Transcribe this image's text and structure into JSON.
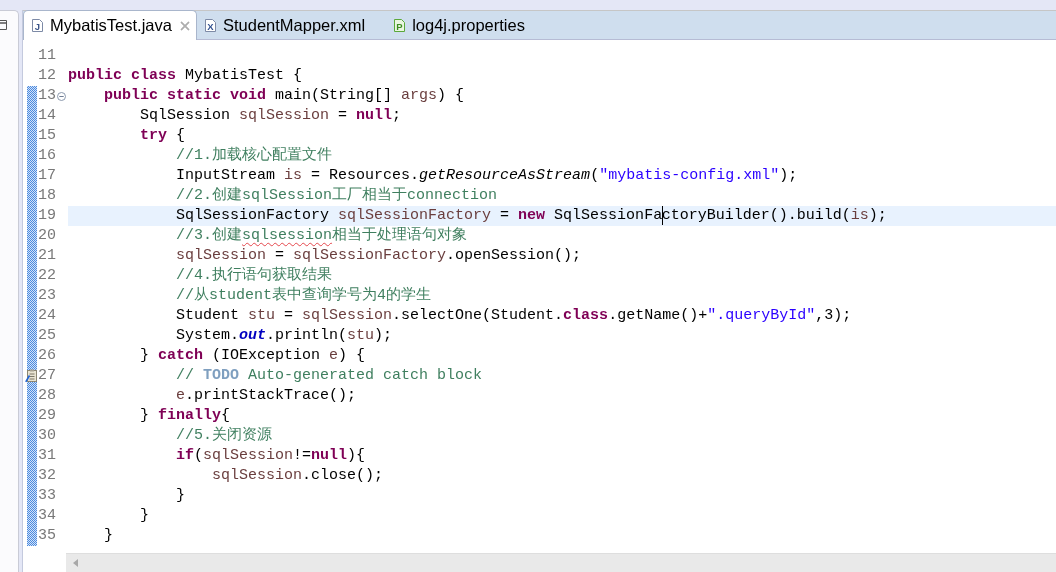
{
  "tabs": [
    {
      "label": "MybatisTest.java",
      "kind": "java",
      "icon_letter": "J",
      "selected": true
    },
    {
      "label": "StudentMapper.xml",
      "kind": "xml",
      "icon_letter": "X",
      "selected": false
    },
    {
      "label": "log4j.properties",
      "kind": "properties",
      "icon_letter": "P",
      "selected": false
    }
  ],
  "editor": {
    "lines": [
      {
        "number": "11",
        "changed": false,
        "current": false,
        "task_marker": false
      },
      {
        "number": "12",
        "changed": false,
        "current": false,
        "task_marker": false,
        "tokens": [
          {
            "text": "public class",
            "kind": "keyword"
          },
          {
            "text": " MybatisTest {",
            "kind": "plain"
          }
        ]
      },
      {
        "number": "13",
        "changed": true,
        "current": false,
        "task_marker": false,
        "fold": {
          "expanded": true
        },
        "tokens": [
          {
            "text": "    public static void",
            "kind": "keyword"
          },
          {
            "text": " main(String[] ",
            "kind": "plain"
          },
          {
            "text": "args",
            "kind": "local"
          },
          {
            "text": ") {",
            "kind": "plain"
          }
        ]
      },
      {
        "number": "14",
        "changed": true,
        "current": false,
        "task_marker": false,
        "tokens": [
          {
            "text": "        SqlSession ",
            "kind": "plain"
          },
          {
            "text": "sqlSession",
            "kind": "local"
          },
          {
            "text": " = ",
            "kind": "plain"
          },
          {
            "text": "null",
            "kind": "keyword"
          },
          {
            "text": ";",
            "kind": "plain"
          }
        ]
      },
      {
        "number": "15",
        "changed": true,
        "current": false,
        "task_marker": false,
        "tokens": [
          {
            "text": "        try",
            "kind": "keyword"
          },
          {
            "text": " {",
            "kind": "plain"
          }
        ]
      },
      {
        "number": "16",
        "changed": true,
        "current": false,
        "task_marker": false,
        "tokens": [
          {
            "text": "            //1.加载核心配置文件",
            "kind": "comment"
          }
        ]
      },
      {
        "number": "17",
        "changed": true,
        "current": false,
        "task_marker": false,
        "tokens": [
          {
            "text": "            InputStream ",
            "kind": "plain"
          },
          {
            "text": "is",
            "kind": "local"
          },
          {
            "text": " = Resources.",
            "kind": "plain"
          },
          {
            "text": "getResourceAsStream",
            "kind": "static_method"
          },
          {
            "text": "(",
            "kind": "plain"
          },
          {
            "text": "\"mybatis-config.xml\"",
            "kind": "string"
          },
          {
            "text": ");",
            "kind": "plain"
          }
        ]
      },
      {
        "number": "18",
        "changed": true,
        "current": false,
        "task_marker": false,
        "tokens": [
          {
            "text": "            //2.创建sqlSession工厂相当于connection",
            "kind": "comment"
          }
        ]
      },
      {
        "number": "19",
        "changed": true,
        "current": true,
        "task_marker": false,
        "tokens": [
          {
            "text": "            SqlSessionFactory ",
            "kind": "plain"
          },
          {
            "text": "sqlSessionFactory",
            "kind": "local"
          },
          {
            "text": " = ",
            "kind": "plain"
          },
          {
            "text": "new",
            "kind": "keyword"
          },
          {
            "text": " SqlSessionFa",
            "kind": "plain"
          },
          {
            "kind": "caret"
          },
          {
            "text": "ctoryBuilder().build(",
            "kind": "plain"
          },
          {
            "text": "is",
            "kind": "local"
          },
          {
            "text": ");",
            "kind": "plain"
          }
        ]
      },
      {
        "number": "20",
        "changed": true,
        "current": false,
        "task_marker": false,
        "tokens": [
          {
            "text": "            //3.创建",
            "kind": "comment"
          },
          {
            "text": "sqlsession",
            "kind": "comment",
            "misspelled": true
          },
          {
            "text": "相当于处理语句对象",
            "kind": "comment"
          }
        ]
      },
      {
        "number": "21",
        "changed": true,
        "current": false,
        "task_marker": false,
        "tokens": [
          {
            "text": "            sqlSession",
            "kind": "local"
          },
          {
            "text": " = ",
            "kind": "plain"
          },
          {
            "text": "sqlSessionFactory",
            "kind": "local"
          },
          {
            "text": ".openSession();",
            "kind": "plain"
          }
        ]
      },
      {
        "number": "22",
        "changed": true,
        "current": false,
        "task_marker": false,
        "tokens": [
          {
            "text": "            //4.执行语句获取结果",
            "kind": "comment"
          }
        ]
      },
      {
        "number": "23",
        "changed": true,
        "current": false,
        "task_marker": false,
        "tokens": [
          {
            "text": "            //从student表中查询学号为4的学生",
            "kind": "comment"
          }
        ]
      },
      {
        "number": "24",
        "changed": true,
        "current": false,
        "task_marker": false,
        "tokens": [
          {
            "text": "            Student ",
            "kind": "plain"
          },
          {
            "text": "stu",
            "kind": "local"
          },
          {
            "text": " = ",
            "kind": "plain"
          },
          {
            "text": "sqlSession",
            "kind": "local"
          },
          {
            "text": ".selectOne(Student.",
            "kind": "plain"
          },
          {
            "text": "class",
            "kind": "keyword"
          },
          {
            "text": ".getName()+",
            "kind": "plain"
          },
          {
            "text": "\".queryById\"",
            "kind": "string"
          },
          {
            "text": ",3);",
            "kind": "plain"
          }
        ]
      },
      {
        "number": "25",
        "changed": true,
        "current": false,
        "task_marker": false,
        "tokens": [
          {
            "text": "            System.",
            "kind": "plain"
          },
          {
            "text": "out",
            "kind": "static_field"
          },
          {
            "text": ".println(",
            "kind": "plain"
          },
          {
            "text": "stu",
            "kind": "local"
          },
          {
            "text": ");",
            "kind": "plain"
          }
        ]
      },
      {
        "number": "26",
        "changed": true,
        "current": false,
        "task_marker": false,
        "tokens": [
          {
            "text": "        } ",
            "kind": "plain"
          },
          {
            "text": "catch",
            "kind": "keyword"
          },
          {
            "text": " (IOException ",
            "kind": "plain"
          },
          {
            "text": "e",
            "kind": "local"
          },
          {
            "text": ") {",
            "kind": "plain"
          }
        ]
      },
      {
        "number": "27",
        "changed": true,
        "current": false,
        "task_marker": true,
        "tokens": [
          {
            "text": "            // ",
            "kind": "comment"
          },
          {
            "text": "TODO",
            "kind": "task_tag"
          },
          {
            "text": " Auto-generated catch block",
            "kind": "comment"
          }
        ]
      },
      {
        "number": "28",
        "changed": true,
        "current": false,
        "task_marker": false,
        "tokens": [
          {
            "text": "            e",
            "kind": "local"
          },
          {
            "text": ".printStackTrace();",
            "kind": "plain"
          }
        ]
      },
      {
        "number": "29",
        "changed": true,
        "current": false,
        "task_marker": false,
        "tokens": [
          {
            "text": "        } ",
            "kind": "plain"
          },
          {
            "text": "finally",
            "kind": "keyword"
          },
          {
            "text": "{",
            "kind": "plain"
          }
        ]
      },
      {
        "number": "30",
        "changed": true,
        "current": false,
        "task_marker": false,
        "tokens": [
          {
            "text": "            //5.关闭资源",
            "kind": "comment"
          }
        ]
      },
      {
        "number": "31",
        "changed": true,
        "current": false,
        "task_marker": false,
        "tokens": [
          {
            "text": "            if",
            "kind": "keyword"
          },
          {
            "text": "(",
            "kind": "plain"
          },
          {
            "text": "sqlSession",
            "kind": "local"
          },
          {
            "text": "!=",
            "kind": "plain"
          },
          {
            "text": "null",
            "kind": "keyword"
          },
          {
            "text": "){",
            "kind": "plain"
          }
        ]
      },
      {
        "number": "32",
        "changed": true,
        "current": false,
        "task_marker": false,
        "tokens": [
          {
            "text": "                sqlSession",
            "kind": "local"
          },
          {
            "text": ".close();",
            "kind": "plain"
          }
        ]
      },
      {
        "number": "33",
        "changed": true,
        "current": false,
        "task_marker": false,
        "tokens": [
          {
            "text": "            }",
            "kind": "plain"
          }
        ]
      },
      {
        "number": "34",
        "changed": true,
        "current": false,
        "task_marker": false,
        "tokens": [
          {
            "text": "        }",
            "kind": "plain"
          }
        ]
      },
      {
        "number": "35",
        "changed": true,
        "current": false,
        "task_marker": false,
        "tokens": [
          {
            "text": "    }",
            "kind": "plain"
          }
        ]
      }
    ]
  }
}
